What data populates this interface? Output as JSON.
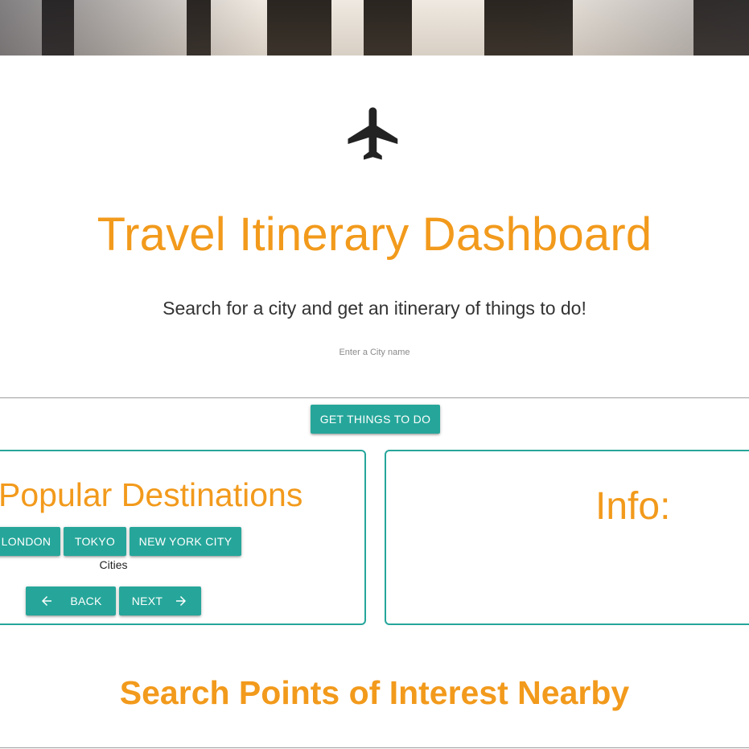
{
  "header": {
    "icon": "airplane-icon",
    "title": "Travel Itinerary Dashboard",
    "tagline": "Search for a city and get an itinerary of things to do!"
  },
  "search": {
    "placeholder": "Enter a City name",
    "value": "",
    "submit_label": "GET THINGS TO DO"
  },
  "popular": {
    "title": "Popular Destinations",
    "cities": [
      "LONDON",
      "TOKYO",
      "NEW YORK CITY"
    ],
    "caption": "Cities",
    "back_label": "BACK",
    "next_label": "NEXT",
    "back_icon": "arrow-left-icon",
    "next_icon": "arrow-right-icon"
  },
  "info": {
    "title": "Info:"
  },
  "poi": {
    "title": "Search Points of Interest Nearby"
  },
  "colors": {
    "accent": "#f29a1c",
    "teal": "#26a69a",
    "text": "#333333"
  }
}
